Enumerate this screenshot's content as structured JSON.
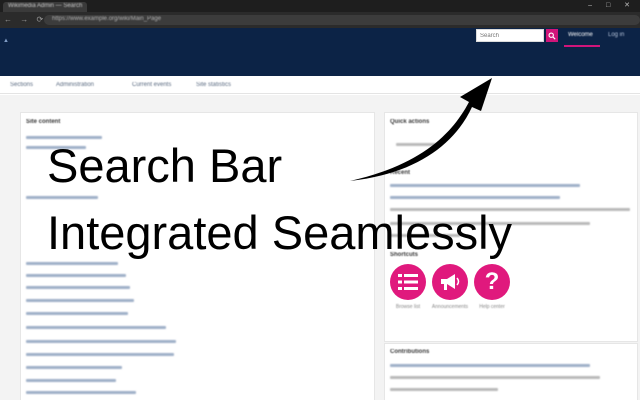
{
  "browser": {
    "tab_title": "Wikimedia Admin — Search",
    "url": "https://www.example.org/wiki/Main_Page",
    "controls": "– □ ✕"
  },
  "header": {
    "search": {
      "placeholder": "Search",
      "value": ""
    },
    "links": [
      {
        "label": "Welcome",
        "active": true
      },
      {
        "label": "Log in",
        "active": false
      }
    ]
  },
  "subnav": {
    "items": [
      "Sections",
      "Administration",
      "Current events",
      "Site statistics"
    ]
  },
  "panels": {
    "left_title": "Site content",
    "right_title": "Quick actions",
    "right_subtitle": "Recent",
    "icons_title": "Shortcuts",
    "shortcuts": [
      {
        "icon": "list-icon",
        "caption": "Browse list"
      },
      {
        "icon": "megaphone-icon",
        "caption": "Announcements"
      },
      {
        "icon": "question-icon",
        "caption": "Help center"
      }
    ],
    "bottom_title": "Contributions"
  },
  "overlay": {
    "line1": "Search Bar",
    "line2": "Integrated Seamlessly"
  },
  "colors": {
    "header_bg": "#0c2346",
    "accent": "#d1157a",
    "page_bg": "#f3f3f3"
  }
}
